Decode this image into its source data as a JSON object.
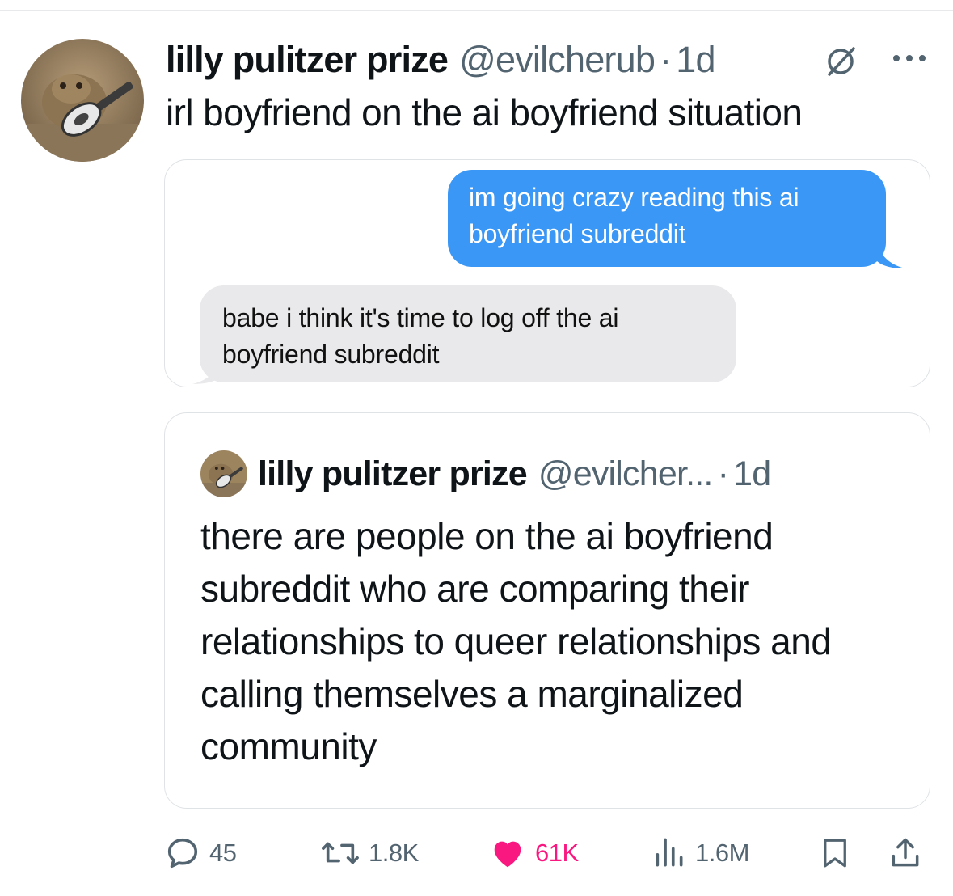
{
  "tweet": {
    "author_name": "lilly pulitzer prize",
    "handle": "@evilcherub",
    "separator": "·",
    "time": "1d",
    "text": "irl boyfriend on the ai boyfriend situation"
  },
  "media": {
    "sent_message": "im going crazy reading this ai boyfriend subreddit",
    "received_message": "babe i think it's time to log off the ai boyfriend subreddit",
    "sent_color": "#3a97f5",
    "received_color": "#e9e9eb"
  },
  "quoted_tweet": {
    "author_name": "lilly pulitzer prize",
    "handle": "@evilcher...",
    "separator": "·",
    "time": "1d",
    "text": "there are people on the ai boyfriend subreddit who are comparing their relationships to queer relationships and calling themselves a marginalized community"
  },
  "actions": {
    "replies": "45",
    "reposts": "1.8K",
    "likes": "61K",
    "views": "1.6M",
    "like_color": "#f91880",
    "icons": [
      "reply-icon",
      "repost-icon",
      "heart-icon",
      "views-icon",
      "bookmark-icon",
      "share-icon"
    ]
  }
}
